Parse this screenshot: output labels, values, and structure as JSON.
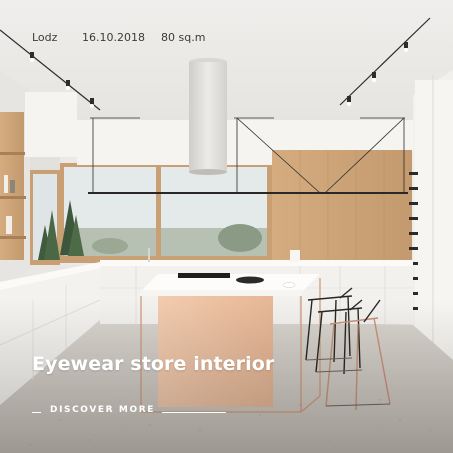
{
  "project": {
    "location": "Lodz",
    "date": "16.10.2018",
    "area": "80 sq.m",
    "title": "Eyewear store interior"
  },
  "cta": {
    "label": "DISCOVER MORE"
  },
  "colors": {
    "text_light": "#ffffff",
    "text_dark": "#3d3b38",
    "wood": "#c9a074",
    "island_peach": "#eec4a6",
    "copper": "#d19c7d"
  },
  "icons": {
    "cta_arrow": "line-dash"
  }
}
